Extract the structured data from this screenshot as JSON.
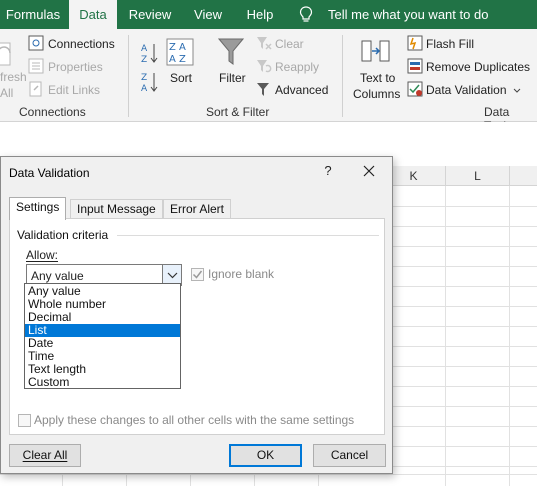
{
  "ribbon": {
    "tabs": [
      {
        "label": "Formulas"
      },
      {
        "label": "Data"
      },
      {
        "label": "Review"
      },
      {
        "label": "View"
      },
      {
        "label": "Help"
      }
    ],
    "tell_me": "Tell me what you want to do",
    "connections": {
      "refresh_partial_1": "fresh",
      "refresh_partial_2": "All",
      "connections": "Connections",
      "properties": "Properties",
      "edit_links": "Edit Links",
      "group_label": "Connections"
    },
    "sort_filter": {
      "sort": "Sort",
      "filter": "Filter",
      "clear": "Clear",
      "reapply": "Reapply",
      "advanced": "Advanced",
      "group_label": "Sort & Filter"
    },
    "data_tools": {
      "text_to_1": "Text to",
      "text_to_2": "Columns",
      "flash_fill": "Flash Fill",
      "remove_duplicates": "Remove Duplicates",
      "data_validation": "Data Validation",
      "group_label": "Data Tools"
    }
  },
  "sheet": {
    "columns": [
      "K",
      "L"
    ]
  },
  "dialog": {
    "title": "Data Validation",
    "help": "?",
    "tabs": [
      "Settings",
      "Input Message",
      "Error Alert"
    ],
    "criteria_label": "Validation criteria",
    "allow_label": "Allow:",
    "allow_value": "Any value",
    "ignore_blank": "Ignore blank",
    "allow_options": [
      "Any value",
      "Whole number",
      "Decimal",
      "List",
      "Date",
      "Time",
      "Text length",
      "Custom"
    ],
    "selected_option": "List",
    "apply_all": "Apply these changes to all other cells with the same settings",
    "buttons": {
      "clear_all": "Clear All",
      "ok": "OK",
      "cancel": "Cancel"
    }
  },
  "colors": {
    "excel_green": "#217346",
    "selection_blue": "#0078d7"
  }
}
